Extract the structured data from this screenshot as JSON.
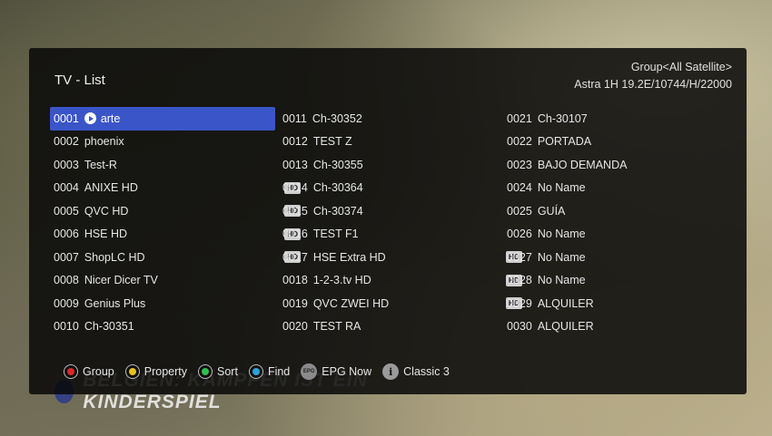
{
  "background": {
    "caption": "BELGIEN: KÄMPFEN IST EIN KINDERSPIEL"
  },
  "header": {
    "title": "TV - List",
    "group": "Group<All Satellite>",
    "satellite": "Astra 1H 19.2E/10744/H/22000"
  },
  "columns": [
    [
      {
        "num": "0001",
        "name": "arte",
        "selected": true,
        "hd": false
      },
      {
        "num": "0002",
        "name": "phoenix",
        "hd": false
      },
      {
        "num": "0003",
        "name": "Test-R",
        "hd": false
      },
      {
        "num": "0004",
        "name": "ANIXE HD",
        "hd": true
      },
      {
        "num": "0005",
        "name": "QVC HD",
        "hd": true
      },
      {
        "num": "0006",
        "name": "HSE HD",
        "hd": true
      },
      {
        "num": "0007",
        "name": "ShopLC HD",
        "hd": true
      },
      {
        "num": "0008",
        "name": "Nicer Dicer TV",
        "hd": false
      },
      {
        "num": "0009",
        "name": "Genius Plus",
        "hd": false
      },
      {
        "num": "0010",
        "name": "Ch-30351",
        "hd": false
      }
    ],
    [
      {
        "num": "0011",
        "name": "Ch-30352",
        "hd": false
      },
      {
        "num": "0012",
        "name": "TEST Z",
        "hd": false
      },
      {
        "num": "0013",
        "name": "Ch-30355",
        "hd": false
      },
      {
        "num": "0014",
        "name": "Ch-30364",
        "hd": false
      },
      {
        "num": "0015",
        "name": "Ch-30374",
        "hd": false
      },
      {
        "num": "0016",
        "name": "TEST F1",
        "hd": false
      },
      {
        "num": "0017",
        "name": "HSE Extra HD",
        "hd": true
      },
      {
        "num": "0018",
        "name": "1-2-3.tv HD",
        "hd": true
      },
      {
        "num": "0019",
        "name": "QVC ZWEI HD",
        "hd": true
      },
      {
        "num": "0020",
        "name": "TEST RA",
        "hd": false
      }
    ],
    [
      {
        "num": "0021",
        "name": "Ch-30107",
        "hd": false
      },
      {
        "num": "0022",
        "name": "PORTADA",
        "hd": false
      },
      {
        "num": "0023",
        "name": "BAJO DEMANDA",
        "hd": false
      },
      {
        "num": "0024",
        "name": "No Name",
        "hd": false
      },
      {
        "num": "0025",
        "name": "GUÍA",
        "hd": false
      },
      {
        "num": "0026",
        "name": "No Name",
        "hd": false
      },
      {
        "num": "0027",
        "name": "No Name",
        "hd": false
      },
      {
        "num": "0028",
        "name": "No Name",
        "hd": false
      },
      {
        "num": "0029",
        "name": "ALQUILER",
        "hd": false
      },
      {
        "num": "0030",
        "name": "ALQUILER",
        "hd": false
      }
    ]
  ],
  "hd_badge": "HD",
  "footer": {
    "keys": [
      {
        "label": "Group",
        "icon": "red-button-icon",
        "color": "#d92b2b"
      },
      {
        "label": "Property",
        "icon": "yellow-button-icon",
        "color": "#e6c021"
      },
      {
        "label": "Sort",
        "icon": "green-button-icon",
        "color": "#2fbf4a"
      },
      {
        "label": "Find",
        "icon": "blue-button-icon",
        "color": "#2aa4d8"
      }
    ],
    "epg": {
      "badge": "EPG",
      "label": "EPG Now",
      "icon": "epg-icon"
    },
    "info": {
      "badge": "i",
      "label": "Classic 3",
      "icon": "info-icon"
    }
  }
}
